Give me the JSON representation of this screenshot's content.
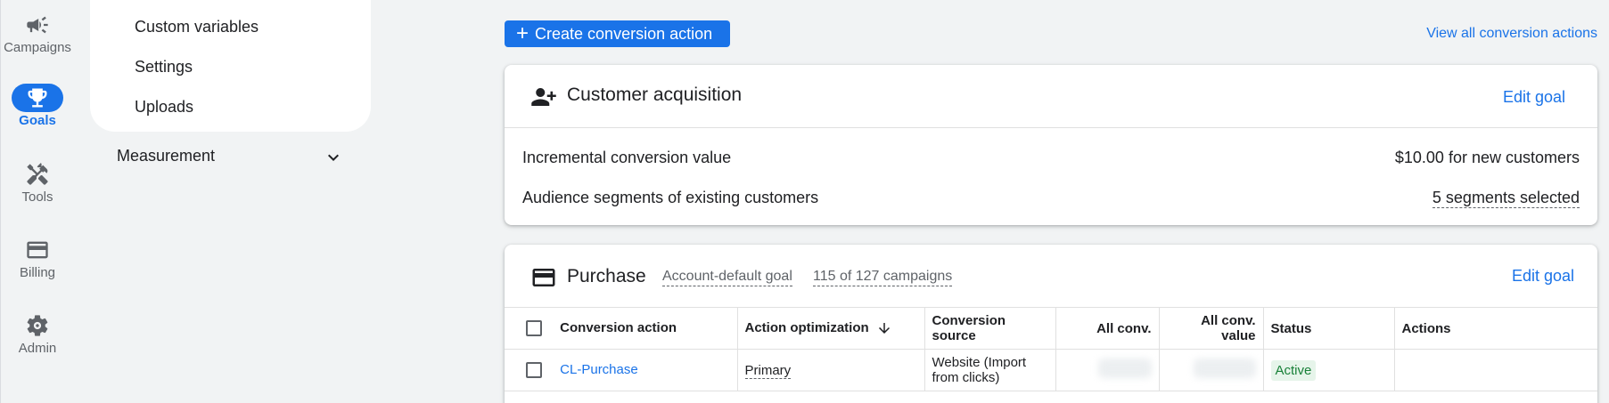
{
  "rail": {
    "items": [
      {
        "label": "Campaigns",
        "icon": "megaphone-icon"
      },
      {
        "label": "Goals",
        "icon": "trophy-icon"
      },
      {
        "label": "Tools",
        "icon": "tools-icon"
      },
      {
        "label": "Billing",
        "icon": "credit-card-icon"
      },
      {
        "label": "Admin",
        "icon": "gear-icon"
      }
    ],
    "accent": "#1a73e8"
  },
  "submenu": {
    "items": [
      "Custom variables",
      "Settings",
      "Uploads"
    ],
    "section": "Measurement"
  },
  "toolbar": {
    "create_label": "Create conversion action",
    "view_all_label": "View all conversion actions"
  },
  "acquisition": {
    "title": "Customer acquisition",
    "edit_label": "Edit goal",
    "rows": [
      {
        "label": "Incremental conversion value",
        "value": "$10.00 for new customers"
      },
      {
        "label": "Audience segments of existing customers",
        "value": "5 segments selected"
      }
    ]
  },
  "purchase": {
    "title": "Purchase",
    "meta_default": "Account-default goal",
    "meta_campaigns": "115 of 127 campaigns",
    "edit_label": "Edit goal",
    "columns": [
      "Conversion action",
      "Action optimization",
      "Conversion source",
      "All conv.",
      "All conv. value",
      "Status",
      "Actions"
    ],
    "rows": [
      {
        "action": "CL-Purchase",
        "optimization": "Primary",
        "source_line1": "Website (Import",
        "source_line2": "from clicks)",
        "status": "Active"
      }
    ]
  }
}
